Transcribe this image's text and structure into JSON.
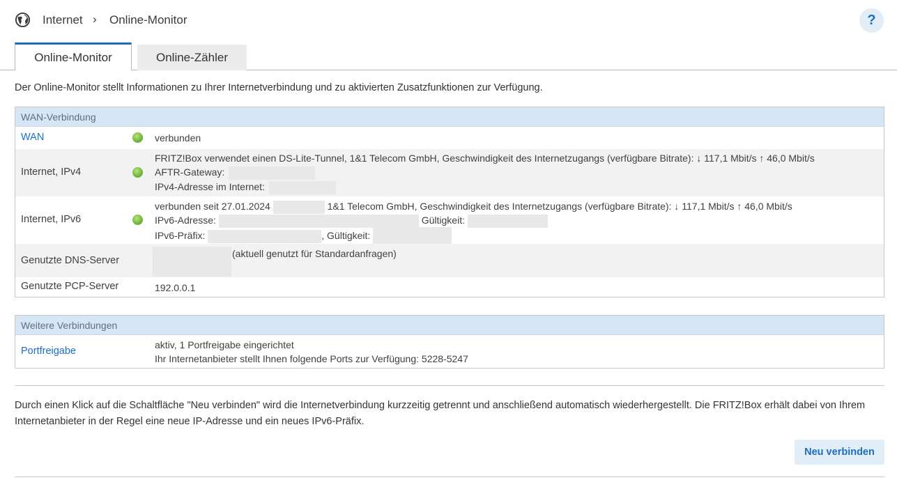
{
  "breadcrumb": {
    "section": "Internet",
    "separator": "›",
    "page": "Online-Monitor"
  },
  "help_label": "?",
  "tabs": [
    {
      "label": "Online-Monitor",
      "active": true
    },
    {
      "label": "Online-Zähler",
      "active": false
    }
  ],
  "intro": "Der Online-Monitor stellt Informationen zu Ihrer Internetverbindung und zu aktivierten Zusatzfunktionen zur Verfügung.",
  "wan": {
    "header": "WAN-Verbindung",
    "rows": {
      "wan": {
        "label": "WAN",
        "status": "verbunden"
      },
      "ipv4": {
        "label": "Internet, IPv4",
        "line1": "FRITZ!Box verwendet einen DS-Lite-Tunnel, 1&1 Telecom GmbH, Geschwindigkeit des Internetzugangs (verfügbare Bitrate): ↓ 117,1 Mbit/s ↑ 46,0 Mbit/s",
        "aftr_label": "AFTR-Gateway:",
        "ipv4_label": "IPv4-Adresse im Internet:"
      },
      "ipv6": {
        "label": "Internet, IPv6",
        "connected_since": "verbunden seit 27.01.2024",
        "provider_speed": "1&1 Telecom GmbH, Geschwindigkeit des Internetzugangs (verfügbare Bitrate): ↓ 117,1 Mbit/s ↑ 46,0 Mbit/s",
        "address_label": "IPv6-Adresse:",
        "validity_label": "Gültigkeit:",
        "prefix_label": "IPv6-Präfix:",
        "prefix_validity_label": ", Gültigkeit:"
      },
      "dns": {
        "label": "Genutzte DNS-Server",
        "note": "(aktuell genutzt für Standardanfragen)"
      },
      "pcp": {
        "label": "Genutzte PCP-Server",
        "value": "192.0.0.1"
      }
    }
  },
  "more": {
    "header": "Weitere Verbindungen",
    "portfreigabe": {
      "label": "Portfreigabe",
      "line1": "aktiv, 1 Portfreigabe eingerichtet",
      "line2": "Ihr Internetanbieter stellt Ihnen folgende Ports zur Verfügung: 5228-5247"
    }
  },
  "note": "Durch einen Klick auf die Schaltfläche \"Neu verbinden\" wird die Internetverbindung kurzzeitig getrennt und anschließend automatisch wiederhergestellt. Die FRITZ!Box erhält dabei von Ihrem Internetanbieter in der Regel eine neue IP-Adresse und ein neues IPv6-Präfix.",
  "reconnect_label": "Neu verbinden",
  "colors": {
    "accent": "#1a6fc0",
    "panel_header": "#d6e6f5",
    "led_green": "#6fb53a"
  },
  "icons": {
    "header": "globe-icon",
    "breadcrumb_separator": "chevron-right-icon",
    "status": "status-led-icon"
  }
}
